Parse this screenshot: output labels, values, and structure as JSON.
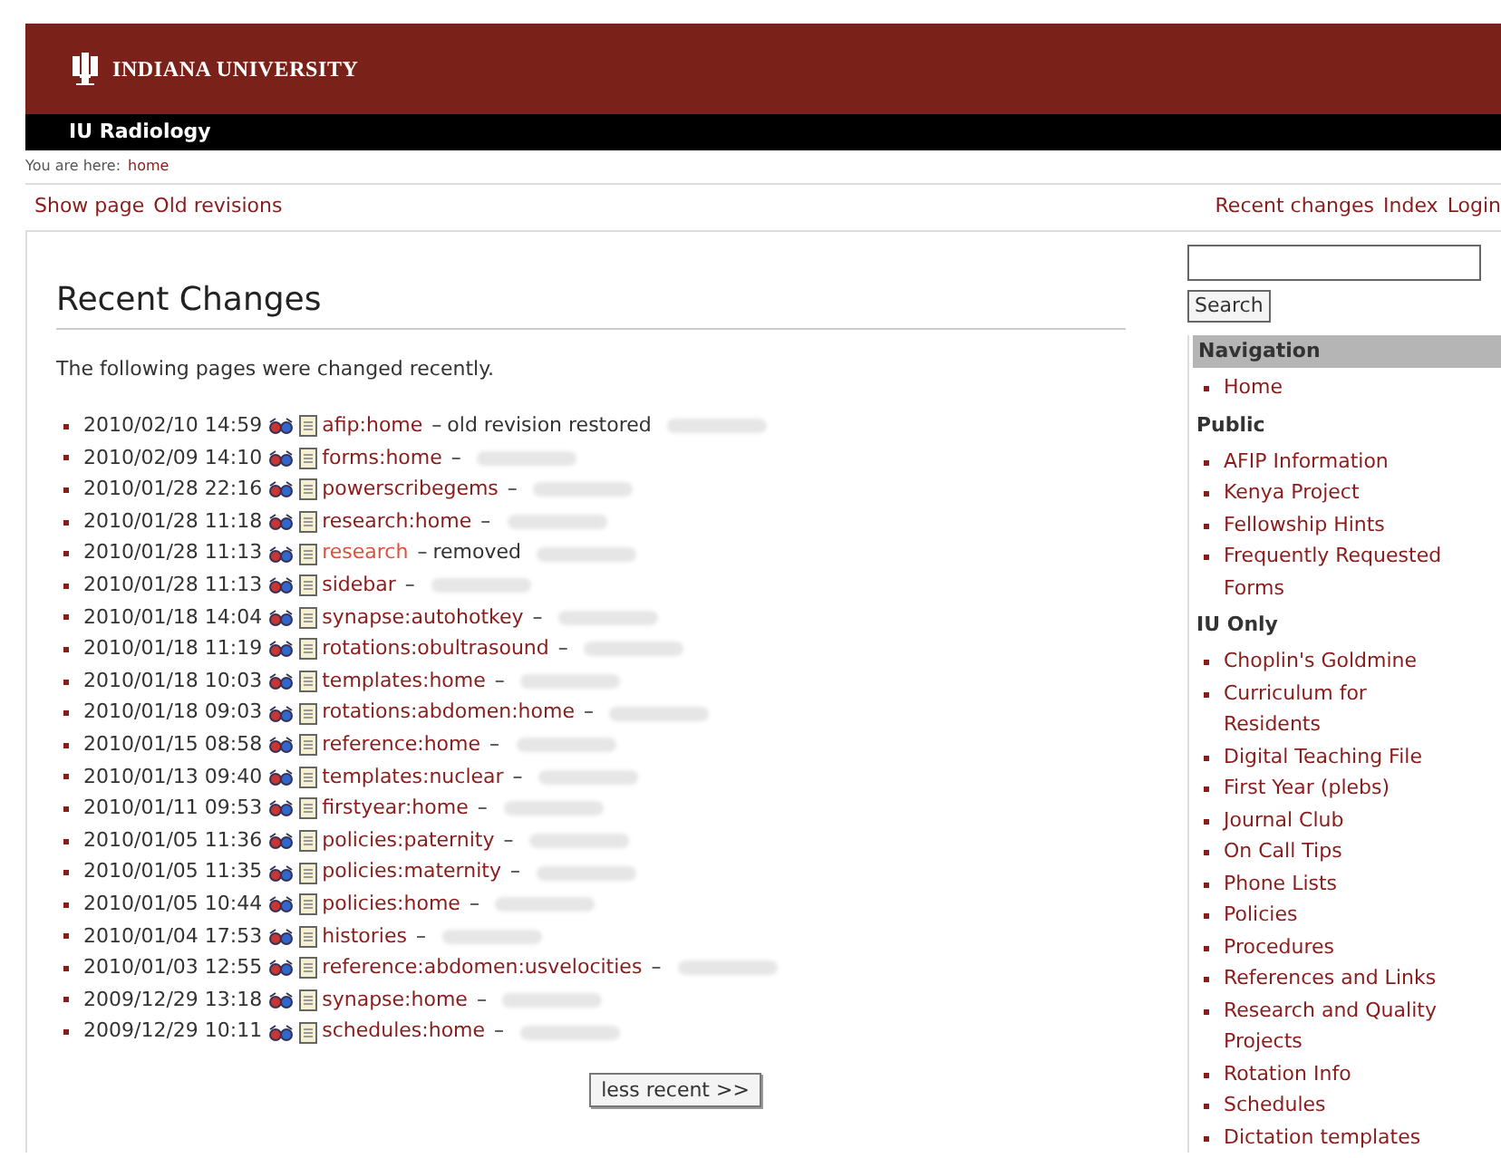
{
  "header": {
    "logo_text": "INDIANA UNIVERSITY",
    "site_title": "IU Radiology"
  },
  "breadcrumb": {
    "label": "You are here:",
    "link": "home"
  },
  "page_actions": [
    "Show page",
    "Old revisions"
  ],
  "user_actions": [
    "Recent changes",
    "Index",
    "Login"
  ],
  "main": {
    "title": "Recent Changes",
    "intro": "The following pages were changed recently.",
    "changes": [
      {
        "date": "2010/02/10 14:59",
        "page": "afip:home",
        "page_exists": true,
        "separator": "–",
        "summary": "old revision restored"
      },
      {
        "date": "2010/02/09 14:10",
        "page": "forms:home",
        "page_exists": true,
        "separator": "–"
      },
      {
        "date": "2010/01/28 22:16",
        "page": "powerscribegems",
        "page_exists": true,
        "separator": "–"
      },
      {
        "date": "2010/01/28 11:18",
        "page": "research:home",
        "page_exists": true,
        "separator": "–"
      },
      {
        "date": "2010/01/28 11:13",
        "page": "research",
        "page_exists": false,
        "separator": "–",
        "summary": "removed"
      },
      {
        "date": "2010/01/28 11:13",
        "page": "sidebar",
        "page_exists": true,
        "separator": "–"
      },
      {
        "date": "2010/01/18 14:04",
        "page": "synapse:autohotkey",
        "page_exists": true,
        "separator": "–"
      },
      {
        "date": "2010/01/18 11:19",
        "page": "rotations:obultrasound",
        "page_exists": true,
        "separator": "–"
      },
      {
        "date": "2010/01/18 10:03",
        "page": "templates:home",
        "page_exists": true,
        "separator": "–"
      },
      {
        "date": "2010/01/18 09:03",
        "page": "rotations:abdomen:home",
        "page_exists": true,
        "separator": "–"
      },
      {
        "date": "2010/01/15 08:58",
        "page": "reference:home",
        "page_exists": true,
        "separator": "–"
      },
      {
        "date": "2010/01/13 09:40",
        "page": "templates:nuclear",
        "page_exists": true,
        "separator": "–"
      },
      {
        "date": "2010/01/11 09:53",
        "page": "firstyear:home",
        "page_exists": true,
        "separator": "–"
      },
      {
        "date": "2010/01/05 11:36",
        "page": "policies:paternity",
        "page_exists": true,
        "separator": "–"
      },
      {
        "date": "2010/01/05 11:35",
        "page": "policies:maternity",
        "page_exists": true,
        "separator": "–"
      },
      {
        "date": "2010/01/05 10:44",
        "page": "policies:home",
        "page_exists": true,
        "separator": "–"
      },
      {
        "date": "2010/01/04 17:53",
        "page": "histories",
        "page_exists": true,
        "separator": "–"
      },
      {
        "date": "2010/01/03 12:55",
        "page": "reference:abdomen:usvelocities",
        "page_exists": true,
        "separator": "–"
      },
      {
        "date": "2009/12/29 13:18",
        "page": "synapse:home",
        "page_exists": true,
        "separator": "–"
      },
      {
        "date": "2009/12/29 10:11",
        "page": "schedules:home",
        "page_exists": true,
        "separator": "–"
      }
    ],
    "pager_button": "less recent >>"
  },
  "sidebar": {
    "search_button": "Search",
    "navigation_title": "Navigation",
    "sections": [
      {
        "items": [
          "Home"
        ]
      },
      {
        "title": "Public",
        "items": [
          "AFIP Information",
          "Kenya Project",
          "Fellowship Hints",
          "Frequently Requested Forms"
        ]
      },
      {
        "title": "IU Only",
        "items": [
          "Choplin's Goldmine",
          "Curriculum for Residents",
          "Digital Teaching File",
          "First Year (plebs)",
          "Journal Club",
          "On Call Tips",
          "Phone Lists",
          "Policies",
          "Procedures",
          "References and Links",
          "Research and Quality Projects",
          "Rotation Info",
          "Schedules",
          "Dictation templates"
        ]
      }
    ]
  }
}
